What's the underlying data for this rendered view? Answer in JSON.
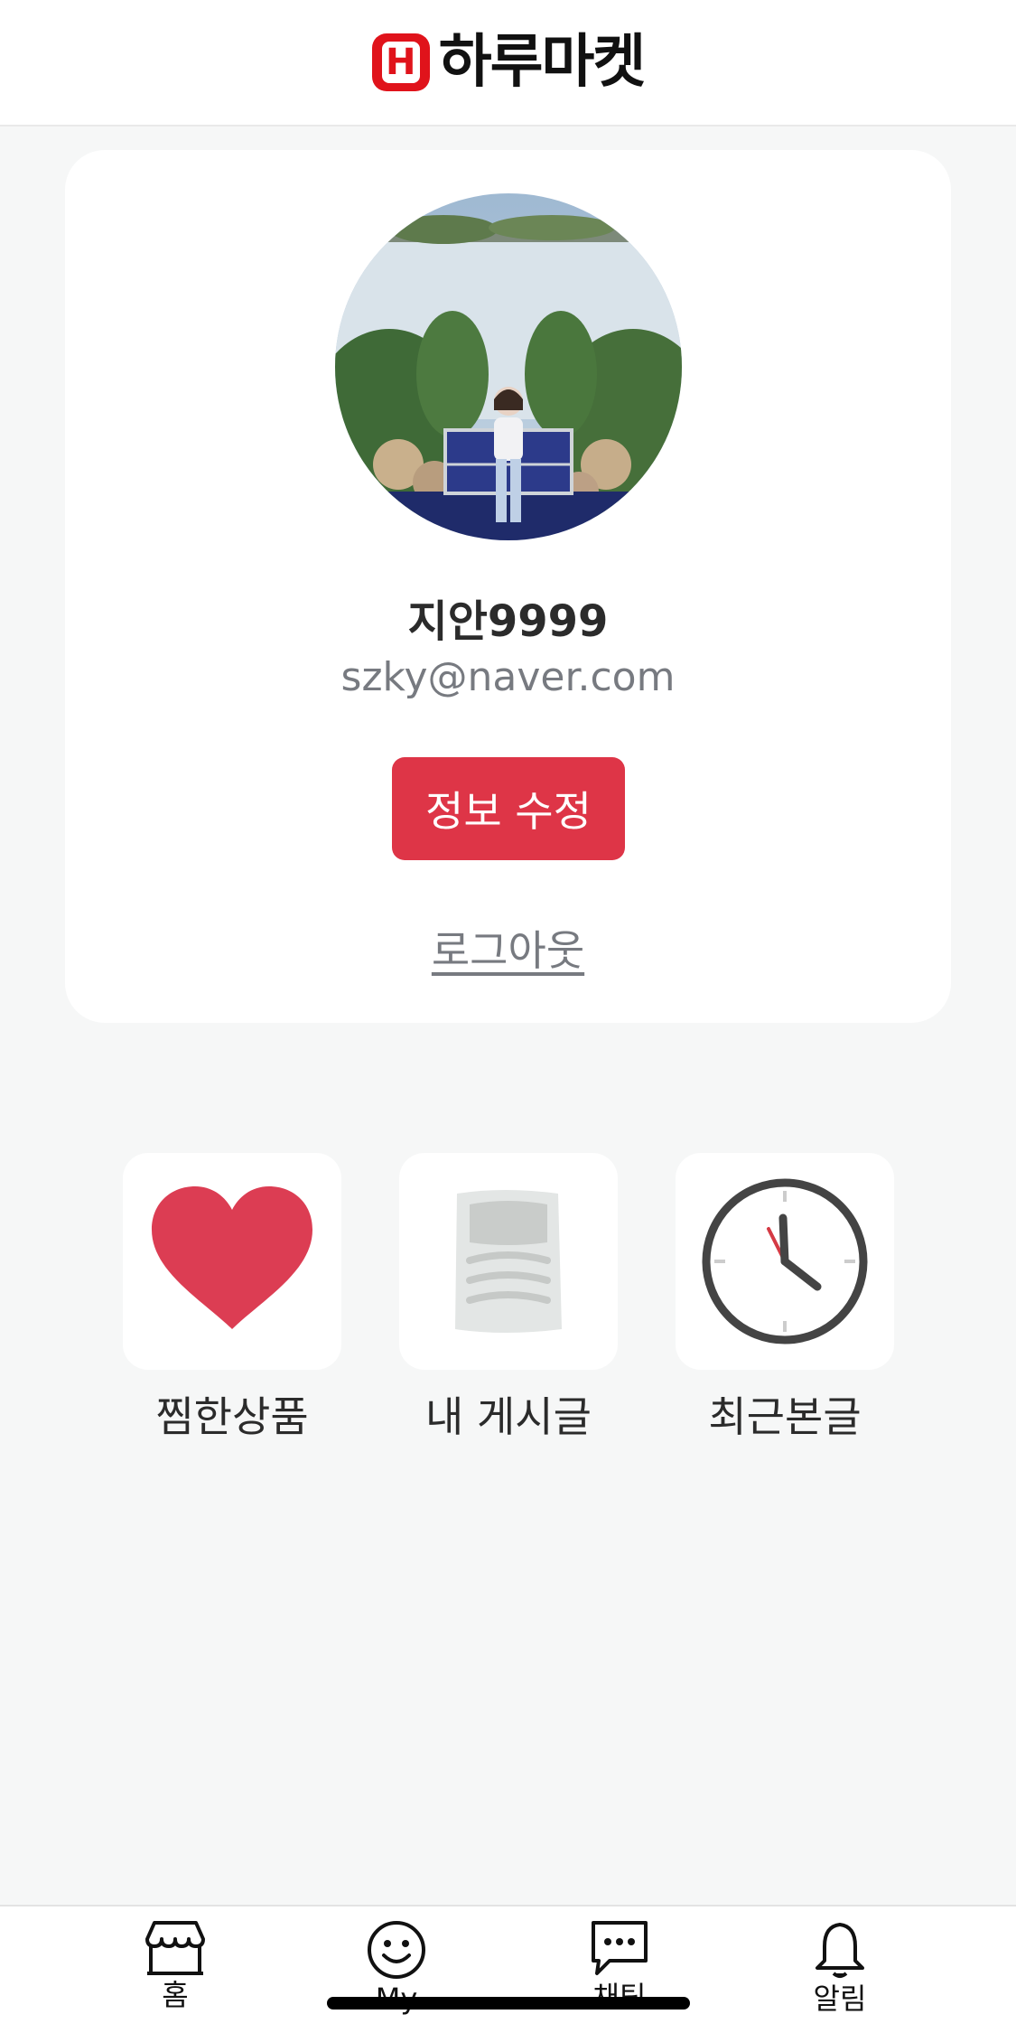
{
  "header": {
    "logo_letter": "H",
    "app_name": "하루마켓",
    "brand_color": "#e0131b"
  },
  "profile": {
    "nickname": "지안9999",
    "email": "szky@naver.com",
    "edit_button_label": "정보 수정",
    "logout_label": "로그아웃",
    "accent_color": "#de3547"
  },
  "shortcuts": [
    {
      "label": "찜한상품",
      "icon": "heart-icon"
    },
    {
      "label": "내 게시글",
      "icon": "document-icon"
    },
    {
      "label": "최근본글",
      "icon": "clock-icon"
    }
  ],
  "bottom_nav": [
    {
      "label": "홈",
      "icon": "store-icon"
    },
    {
      "label": "My",
      "icon": "smiley-icon"
    },
    {
      "label": "채팅",
      "icon": "chat-bubble-icon"
    },
    {
      "label": "알림",
      "icon": "bell-icon"
    }
  ]
}
